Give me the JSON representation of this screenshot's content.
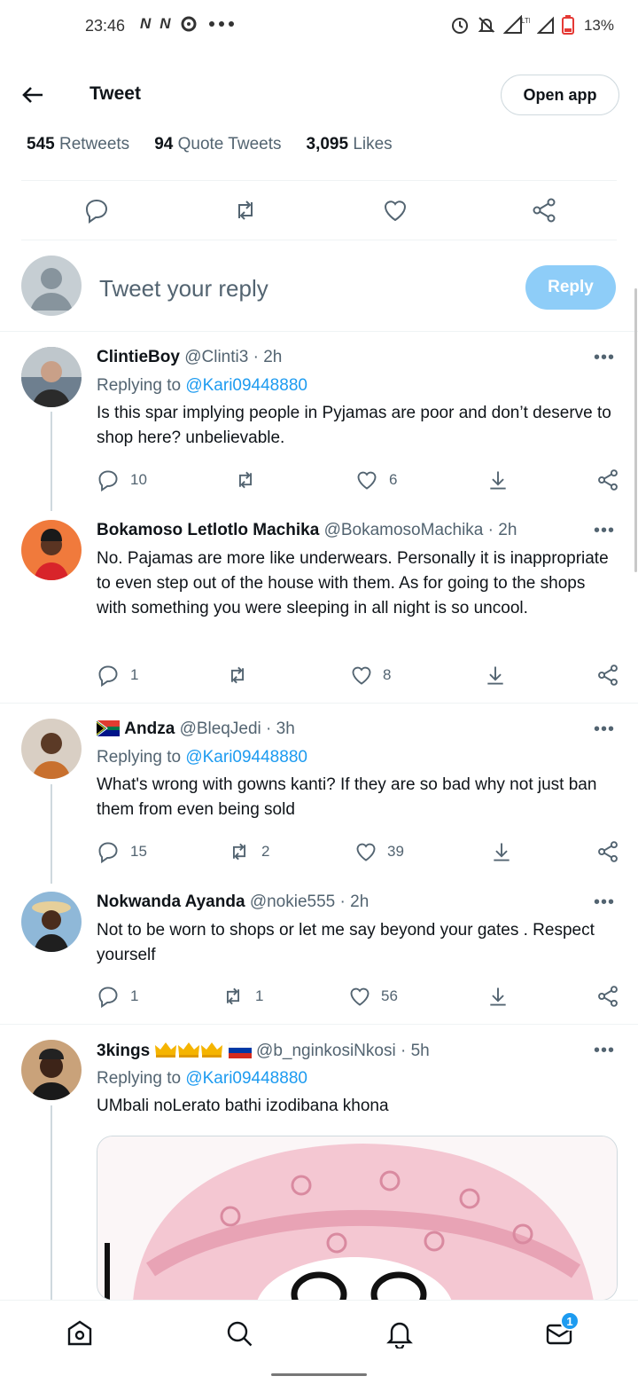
{
  "status_bar": {
    "time": "23:46",
    "left_icons": [
      "N",
      "N",
      "sync-icon",
      "more-dots"
    ],
    "right_icons": [
      "alarm-icon",
      "mute-icon",
      "signal-lte-icon",
      "signal-icon",
      "battery-icon"
    ],
    "lte": "LTE",
    "battery": "13%"
  },
  "header": {
    "title": "Tweet",
    "open_app_label": "Open app"
  },
  "stats": {
    "retweets_count": "545",
    "retweets_label": "Retweets",
    "quotes_count": "94",
    "quotes_label": "Quote Tweets",
    "likes_count": "3,095",
    "likes_label": "Likes"
  },
  "composer": {
    "placeholder": "Tweet your reply",
    "reply_label": "Reply"
  },
  "tweets": [
    {
      "name": "ClintieBoy",
      "handle": "@Clinti3",
      "time": "· 2h",
      "replying_prefix": "Replying to",
      "replying_handle": "@Kari09448880",
      "text": "Is this spar implying people in Pyjamas are poor and don’t deserve to shop here? unbelievable.",
      "replies": "10",
      "retweets": "",
      "likes": "6"
    },
    {
      "name": "Bokamoso Letlotlo Machika",
      "handle": "@BokamosoMachika",
      "time": "· 2h",
      "text": "No. Pajamas are more like underwears. Personally it is inappropriate to even step out of the house with them. As for going to the shops with something you were sleeping in all night is so uncool.",
      "replies": "1",
      "retweets": "",
      "likes": "8"
    },
    {
      "name": "Andza",
      "handle": "@BleqJedi",
      "time": "· 3h",
      "replying_prefix": "Replying to",
      "replying_handle": "@Kari09448880",
      "text": "What's wrong with gowns kanti? If they are so bad why not just ban them from even being sold",
      "replies": "15",
      "retweets": "2",
      "likes": "39"
    },
    {
      "name": "Nokwanda Ayanda",
      "handle": "@nokie555",
      "time": "· 2h",
      "text": "Not to be worn to shops or let me say beyond your gates . Respect yourself",
      "replies": "1",
      "retweets": "1",
      "likes": "56"
    },
    {
      "name": "3kings",
      "handle": "@b_nginkosiNkosi",
      "time": "· 5h",
      "replying_prefix": "Replying to",
      "replying_handle": "@Kari09448880",
      "text": "UMbali noLerato bathi izodibana khona"
    }
  ],
  "bottom_nav": {
    "items": [
      "home-icon",
      "search-icon",
      "notifications-icon",
      "messages-icon"
    ],
    "messages_badge": "1"
  },
  "colors": {
    "accent": "#1d9bf0",
    "reply_button_disabled": "#8ecdf8",
    "secondary_text": "#536471",
    "primary_text": "#0f1419",
    "divider": "#eff3f4"
  }
}
